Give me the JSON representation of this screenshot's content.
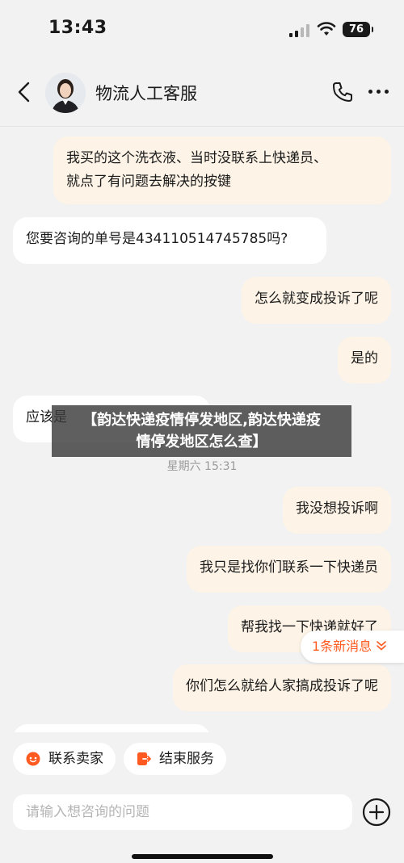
{
  "status_bar": {
    "time": "13:43",
    "battery": "76"
  },
  "header": {
    "title": "物流人工客服"
  },
  "messages": [
    {
      "from": "user",
      "text": "我买的这个洗衣液、当时没联系上快递员、\n就点了有问题去解决的按键"
    },
    {
      "from": "agent",
      "text": "您要咨询的单号是434110514745785吗?"
    },
    {
      "from": "user",
      "text": "怎么就变成投诉了呢"
    },
    {
      "from": "user",
      "text": "是的"
    },
    {
      "from": "agent",
      "text": "应该是"
    },
    {
      "from": "user",
      "text": "我没想投诉啊"
    },
    {
      "from": "user",
      "text": "我只是找你们联系一下快递员"
    },
    {
      "from": "user",
      "text": "帮我找一下快递就好了"
    },
    {
      "from": "user",
      "text": "你们怎么就给人家搞成投诉了呢"
    }
  ],
  "timestamp": "星期六 15:31",
  "overlay_banner": "【韵达快递疫情停发地区,韵达快递疫\n情停发地区怎么查】",
  "new_messages": "1条新消息",
  "quick_actions": {
    "contact_seller": "联系卖家",
    "end_service": "结束服务"
  },
  "input": {
    "placeholder": "请输入想咨询的问题"
  },
  "colors": {
    "accent": "#ff5a1f",
    "user_bubble": "#fdf3e6",
    "agent_bubble": "#ffffff"
  }
}
